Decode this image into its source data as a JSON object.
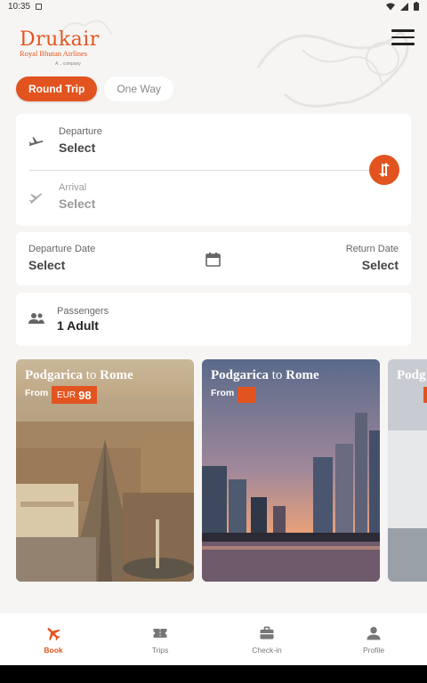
{
  "status_bar": {
    "time": "10:35"
  },
  "header": {
    "brand": "Drukair",
    "subtitle": "Royal Bhutan Airlines",
    "tiny": "A .. company"
  },
  "trip_type": {
    "round_trip": "Round Trip",
    "one_way": "One Way",
    "selected": "Round Trip"
  },
  "route": {
    "departure_label": "Departure",
    "departure_value": "Select",
    "arrival_label": "Arrival",
    "arrival_value": "Select"
  },
  "dates": {
    "departure_label": "Departure Date",
    "departure_value": "Select",
    "return_label": "Return Date",
    "return_value": "Select"
  },
  "passengers": {
    "label": "Passengers",
    "value": "1 Adult"
  },
  "destinations": [
    {
      "origin": "Podgarica",
      "to": "to",
      "dest": "Rome",
      "from_label": "From",
      "currency": "EUR",
      "price": "98"
    },
    {
      "origin": "Podgarica",
      "to": "to",
      "dest": "Rome",
      "from_label": "From",
      "currency": "",
      "price": ""
    },
    {
      "origin": "Podg",
      "to": "",
      "dest": "",
      "from_label": "",
      "currency": "",
      "price": ""
    }
  ],
  "bottom_nav": [
    {
      "label": "Book",
      "icon": "plane-icon",
      "active": true
    },
    {
      "label": "Trips",
      "icon": "ticket-icon",
      "active": false
    },
    {
      "label": "Check-in",
      "icon": "briefcase-icon",
      "active": false
    },
    {
      "label": "Profile",
      "icon": "person-icon",
      "active": false
    }
  ],
  "colors": {
    "accent": "#e2541f",
    "background": "#f6f5f4",
    "card": "#ffffff"
  }
}
